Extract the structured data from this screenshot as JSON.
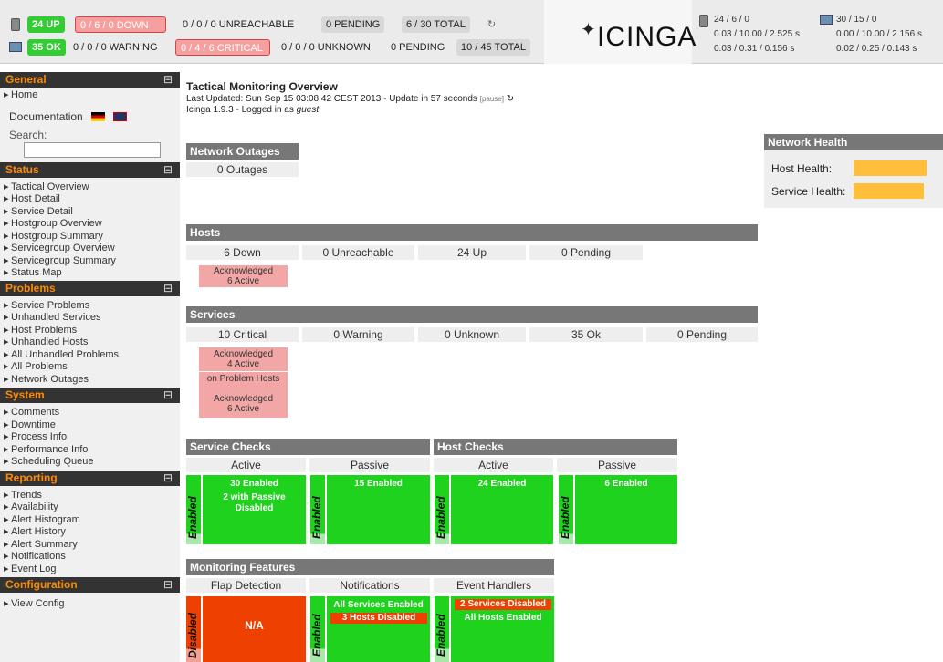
{
  "top": {
    "hosts": {
      "up": "24 UP",
      "down": "0 / 6 / 0 DOWN",
      "unreachable": "0 / 0 / 0 UNREACHABLE",
      "pending": "0 PENDING",
      "total": "6 / 30 TOTAL"
    },
    "services": {
      "ok": "35 OK",
      "warning": "0 / 0 / 0 WARNING",
      "critical": "0 / 4 / 6 CRITICAL",
      "unknown": "0 / 0 / 0 UNKNOWN",
      "pending": "0 PENDING",
      "total": "10 / 45 TOTAL"
    },
    "refresh_icon": "refresh-icon",
    "logo": "ICINGA",
    "perf": {
      "h1": "24 / 6 / 0",
      "h2": "0.03 / 10.00 / 2.525 s",
      "h3": "0.03 / 0.31 / 0.156 s",
      "s1": "30 / 15 / 0",
      "s2": "0.00 / 10.00 / 2.156 s",
      "s3": "0.02 / 0.25 / 0.143 s"
    }
  },
  "sidebar": {
    "general": "General",
    "home": "Home",
    "documentation": "Documentation",
    "search": "Search:",
    "status": "Status",
    "status_items": [
      "Tactical Overview",
      "Host Detail",
      "Service Detail",
      "Hostgroup Overview",
      "Hostgroup Summary",
      "Servicegroup Overview",
      "Servicegroup Summary",
      "Status Map"
    ],
    "problems": "Problems",
    "problem_items": [
      "Service Problems",
      "Unhandled Services",
      "Host Problems",
      "Unhandled Hosts",
      "All Unhandled Problems",
      "All Problems",
      "Network Outages"
    ],
    "system": "System",
    "system_items": [
      "Comments",
      "Downtime",
      "Process Info",
      "Performance Info",
      "Scheduling Queue"
    ],
    "reporting": "Reporting",
    "reporting_items": [
      "Trends",
      "Availability",
      "Alert Histogram",
      "Alert History",
      "Alert Summary",
      "Notifications",
      "Event Log"
    ],
    "configuration": "Configuration",
    "config_items": [
      "View Config"
    ],
    "minus": "⊟"
  },
  "main": {
    "title": "Tactical Monitoring Overview",
    "updated": "Last Updated: Sun Sep 15 03:08:42 CEST 2013 - Update in 57 seconds",
    "pause": "[pause]",
    "version": "Icinga 1.9.3 - Logged in as",
    "user": "guest",
    "outages": {
      "title": "Network Outages",
      "value": "0 Outages"
    },
    "health": {
      "title": "Network Health",
      "host": "Host Health:",
      "service": "Service Health:"
    },
    "hosts": {
      "title": "Hosts",
      "down": "6 Down",
      "unreachable": "0 Unreachable",
      "up": "24 Up",
      "pending": "0 Pending",
      "ack1": "Acknowledged",
      "ack2": "6 Active"
    },
    "services": {
      "title": "Services",
      "critical": "10 Critical",
      "warning": "0 Warning",
      "unknown": "0 Unknown",
      "ok": "35 Ok",
      "pending": "0 Pending",
      "a1": "Acknowledged",
      "a2": "4 Active",
      "onprob": "on Problem Hosts",
      "b1": "Acknowledged",
      "b2": "6 Active"
    },
    "svc_checks": {
      "title": "Service Checks",
      "active": "Active",
      "passive": "Passive",
      "enabled": "Enabled",
      "a1": "30 Enabled",
      "a2": "2 with Passive",
      "a3": "Disabled",
      "p1": "15 Enabled"
    },
    "host_checks": {
      "title": "Host Checks",
      "active": "Active",
      "passive": "Passive",
      "enabled": "Enabled",
      "a1": "24 Enabled",
      "p1": "6 Enabled"
    },
    "features": {
      "title": "Monitoring Features",
      "flap": "Flap Detection",
      "notif": "Notifications",
      "handlers": "Event Handlers",
      "disabled": "Disabled",
      "enabled": "Enabled",
      "na": "N/A",
      "n1": "All Services Enabled",
      "n2": "3 Hosts Disabled",
      "e1": "2 Services Disabled",
      "e2": "All Hosts Enabled"
    }
  }
}
